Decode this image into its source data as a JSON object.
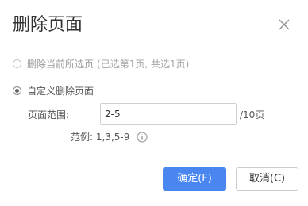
{
  "dialog": {
    "title": "删除页面",
    "close_icon": "close-icon"
  },
  "options": {
    "current": {
      "label": "删除当前所选页",
      "note": "(已选第1页, 共选1页)",
      "checked": false
    },
    "custom": {
      "label": "自定义删除页面",
      "checked": true
    }
  },
  "range": {
    "label": "页面范围:",
    "value": "2-5",
    "total": "/10页"
  },
  "example": {
    "text": "范例: 1,3,5-9",
    "icon": "info-icon"
  },
  "buttons": {
    "ok": "确定(F)",
    "cancel": "取消(C)"
  },
  "colors": {
    "primary": "#4a86f0"
  }
}
